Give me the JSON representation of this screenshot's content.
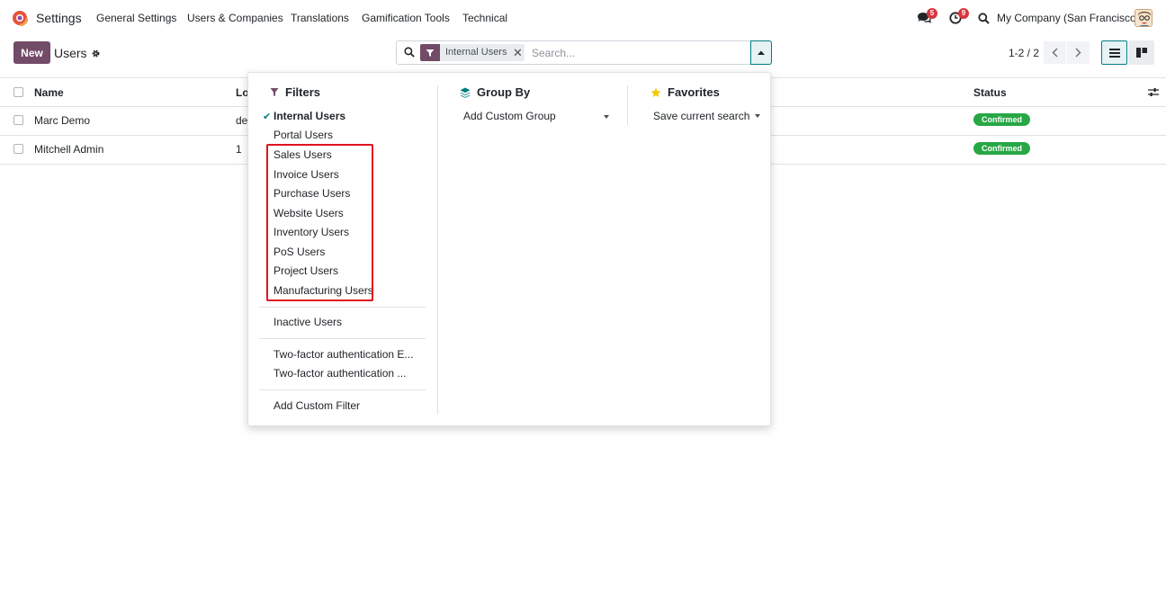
{
  "navbar": {
    "app_name": "Settings",
    "menu": [
      "General Settings",
      "Users & Companies",
      "Translations",
      "Gamification Tools",
      "Technical"
    ],
    "messages_count": "5",
    "activities_count": "9",
    "company": "My Company (San Francisco)"
  },
  "control_panel": {
    "new_label": "New",
    "breadcrumb": "Users",
    "facet_label": "Internal Users",
    "search_placeholder": "Search...",
    "pager": "1-2 / 2"
  },
  "list": {
    "columns": [
      "Name",
      "Lo",
      "Status"
    ],
    "rows": [
      {
        "name": "Marc Demo",
        "login": "de",
        "status": "Confirmed"
      },
      {
        "name": "Mitchell Admin",
        "login": "1",
        "status": "Confirmed"
      }
    ]
  },
  "dropdown": {
    "filters_title": "Filters",
    "filters_active": "Internal Users",
    "filters_portal": "Portal Users",
    "filters_highlighted": [
      "Sales Users",
      "Invoice Users",
      "Purchase Users",
      "Website Users",
      "Inventory Users",
      "PoS Users",
      "Project Users",
      "Manufacturing Users"
    ],
    "filters_inactive": "Inactive Users",
    "filters_2fa": [
      "Two-factor authentication E...",
      "Two-factor authentication ..."
    ],
    "add_custom_filter": "Add Custom Filter",
    "group_by_title": "Group By",
    "add_custom_group": "Add Custom Group",
    "favorites_title": "Favorites",
    "save_current_search": "Save current search"
  },
  "colors": {
    "brand": "#714b67",
    "accent": "#017e84",
    "success": "#28a745",
    "highlight": "#e0141e",
    "favorite_star": "#f3cc00"
  }
}
